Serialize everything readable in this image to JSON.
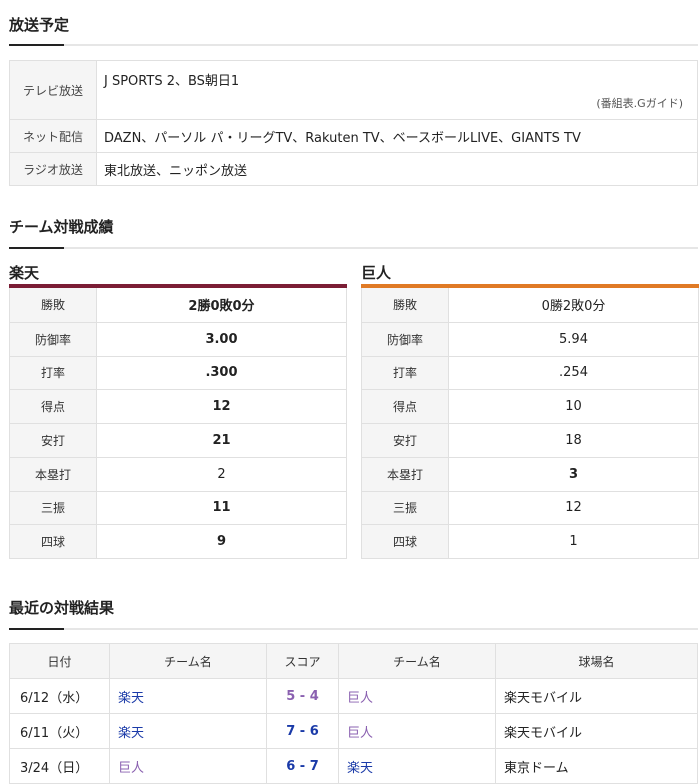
{
  "broadcast": {
    "title": "放送予定",
    "rows": [
      {
        "label": "テレビ放送",
        "value": "J SPORTS 2、BS朝日1",
        "note": "(番組表.Gガイド)"
      },
      {
        "label": "ネット配信",
        "value": "DAZN、パーソル パ・リーグTV、Rakuten TV、ベースボールLIVE、GIANTS TV"
      },
      {
        "label": "ラジオ放送",
        "value": "東北放送、ニッポン放送"
      }
    ]
  },
  "team_record": {
    "title": "チーム対戦成績",
    "teams": [
      {
        "name": "楽天",
        "bar_color": "#7b1d35",
        "stats": [
          {
            "label": "勝敗",
            "value": "2勝0敗0分",
            "bold": true
          },
          {
            "label": "防御率",
            "value": "3.00",
            "bold": true
          },
          {
            "label": "打率",
            "value": ".300",
            "bold": true
          },
          {
            "label": "得点",
            "value": "12",
            "bold": true
          },
          {
            "label": "安打",
            "value": "21",
            "bold": true
          },
          {
            "label": "本塁打",
            "value": "2",
            "bold": false
          },
          {
            "label": "三振",
            "value": "11",
            "bold": true
          },
          {
            "label": "四球",
            "value": "9",
            "bold": true
          }
        ]
      },
      {
        "name": "巨人",
        "bar_color": "#e07a25",
        "stats": [
          {
            "label": "勝敗",
            "value": "0勝2敗0分",
            "bold": false
          },
          {
            "label": "防御率",
            "value": "5.94",
            "bold": false
          },
          {
            "label": "打率",
            "value": ".254",
            "bold": false
          },
          {
            "label": "得点",
            "value": "10",
            "bold": false
          },
          {
            "label": "安打",
            "value": "18",
            "bold": false
          },
          {
            "label": "本塁打",
            "value": "3",
            "bold": true
          },
          {
            "label": "三振",
            "value": "12",
            "bold": false
          },
          {
            "label": "四球",
            "value": "1",
            "bold": false
          }
        ]
      }
    ]
  },
  "recent": {
    "title": "最近の対戦結果",
    "headers": [
      "日付",
      "チーム名",
      "スコア",
      "チーム名",
      "球場名"
    ],
    "rows": [
      {
        "date": "6/12（水）",
        "team1": "楽天",
        "team1_color": "#1a3aa8",
        "score": "5 - 4",
        "score_color": "#8a60b0",
        "team2": "巨人",
        "team2_color": "#8a60b0",
        "park": "楽天モバイル"
      },
      {
        "date": "6/11（火）",
        "team1": "楽天",
        "team1_color": "#1a3aa8",
        "score": "7 - 6",
        "score_color": "#1a3aa8",
        "team2": "巨人",
        "team2_color": "#8a60b0",
        "park": "楽天モバイル"
      },
      {
        "date": "3/24（日）",
        "team1": "巨人",
        "team1_color": "#8a60b0",
        "score": "6 - 7",
        "score_color": "#1a3aa8",
        "team2": "楽天",
        "team2_color": "#1a3aa8",
        "park": "東京ドーム"
      }
    ]
  }
}
